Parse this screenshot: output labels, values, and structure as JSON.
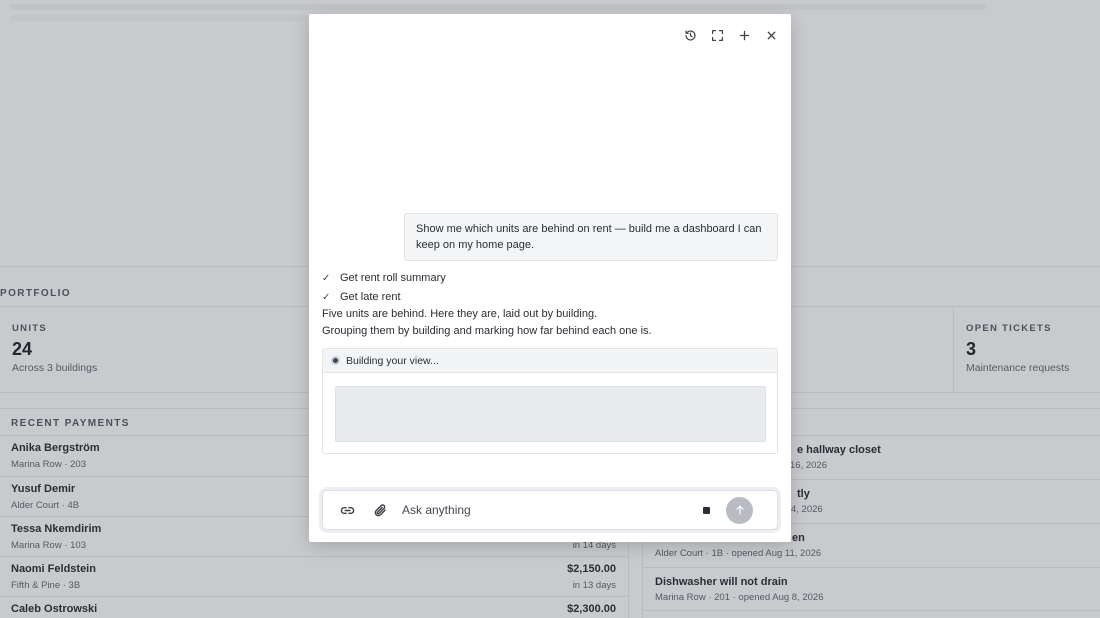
{
  "portfolio": {
    "section_label": "PORTFOLIO",
    "stats": [
      {
        "title": "UNITS",
        "value": "24",
        "sub": "Across 3 buildings"
      },
      {
        "title": "OPEN TICKETS",
        "value": "3",
        "sub": "Maintenance requests"
      }
    ]
  },
  "recent_payments": {
    "label": "RECENT PAYMENTS",
    "rows": [
      {
        "name": "Anika Bergström",
        "sub": "Marina Row · 203",
        "amount": "",
        "due": ""
      },
      {
        "name": "Yusuf Demir",
        "sub": "Alder Court · 4B",
        "amount": "",
        "due": ""
      },
      {
        "name": "Tessa Nkemdirim",
        "sub": "Marina Row · 103",
        "amount": "",
        "due": "in 14 days"
      },
      {
        "name": "Naomi Feldstein",
        "sub": "Fifth & Pine · 3B",
        "amount": "$2,150.00",
        "due": "in 13 days"
      },
      {
        "name": "Caleb Ostrowski",
        "sub": "",
        "amount": "$2,300.00",
        "due": ""
      }
    ]
  },
  "tickets": {
    "rows": [
      {
        "title": "e hallway closet",
        "sub": "16, 2026"
      },
      {
        "title": "tly",
        "sub": "4, 2026"
      },
      {
        "title": "en",
        "sub": "Alder Court · 1B · opened Aug 11, 2026"
      },
      {
        "title": "Dishwasher will not drain",
        "sub": "Marina Row · 201 · opened Aug 8, 2026"
      }
    ]
  },
  "chat": {
    "tools": [
      "history-icon",
      "fullscreen-icon",
      "plus-icon",
      "close-icon"
    ],
    "user_message": "Show me which units are behind on rent — build me a dashboard I can keep on my home page.",
    "steps": [
      "Get rent roll summary",
      "Get late rent"
    ],
    "assistant_lines": [
      "Five units are behind. Here they are, laid out by building.",
      "Grouping them by building and marking how far behind each one is."
    ],
    "build_status": "Building your view...",
    "composer_placeholder": "Ask anything"
  }
}
